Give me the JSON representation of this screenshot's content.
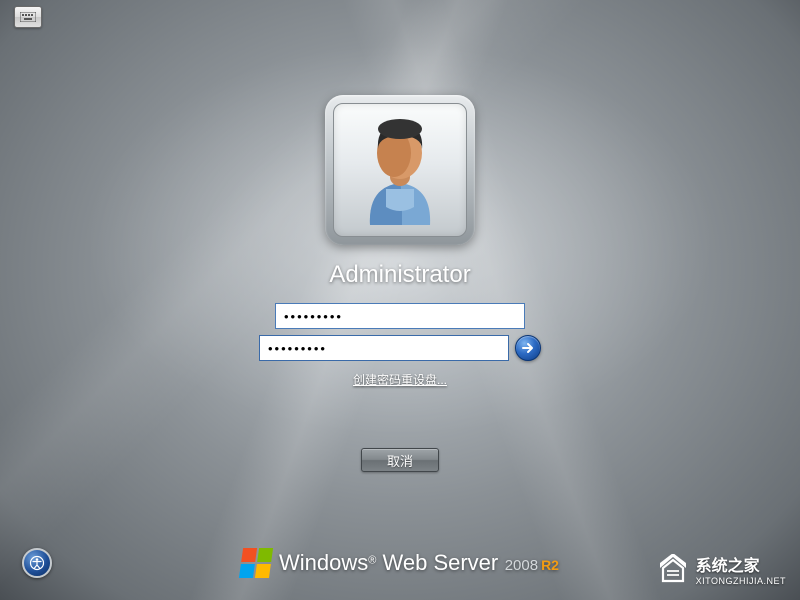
{
  "login": {
    "username": "Administrator",
    "password1_mask": "●●●●●●●●●",
    "password2_mask": "●●●●●●●●●",
    "reset_link_label": "创建密码重设盘...",
    "cancel_label": "取消"
  },
  "brand": {
    "product_prefix": "Windows",
    "product_mid": " Web Server",
    "year": "2008",
    "suffix": "R2"
  },
  "watermark": {
    "site_name": "系统之家",
    "url": "XITONGZHIJIA.NET"
  },
  "colors": {
    "accent_blue": "#1f5fb0",
    "suffix_orange": "#f39c12"
  }
}
